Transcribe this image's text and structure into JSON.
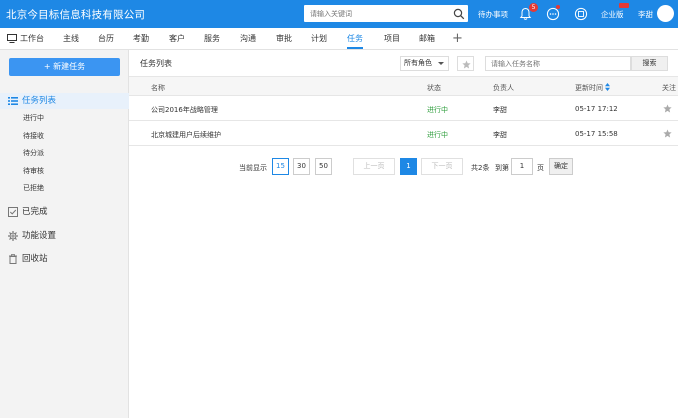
{
  "header": {
    "company": "北京今目标信息科技有限公司",
    "search_placeholder": "请输入关键词",
    "todo": "待办事项",
    "notif_count": "5",
    "enterprise": "企业版",
    "user": "李甜"
  },
  "nav": {
    "items": [
      "工作台",
      "主线",
      "台历",
      "考勤",
      "客户",
      "服务",
      "沟通",
      "审批",
      "计划",
      "任务",
      "项目",
      "邮箱"
    ],
    "active": "任务"
  },
  "sidebar": {
    "new_task": "+ 新建任务",
    "task_list": "任务列表",
    "sub_items": [
      "进行中",
      "待接收",
      "待分派",
      "待审核",
      "已拒绝"
    ],
    "completed": "已完成",
    "settings": "功能设置",
    "recycle": "回收站"
  },
  "main": {
    "title": "任务列表",
    "role_select": "所有角色",
    "search_placeholder": "请输入任务名称",
    "search_button": "搜索",
    "columns": [
      "名称",
      "状态",
      "负责人",
      "更新时间",
      "关注"
    ],
    "rows": [
      {
        "name": "公司2016年战略管理",
        "status": "进行中",
        "owner": "李甜",
        "updated": "05-17 17:12"
      },
      {
        "name": "北京城建用户后续维护",
        "status": "进行中",
        "owner": "李甜",
        "updated": "05-17 15:58"
      }
    ]
  },
  "pagination": {
    "show_label": "当前显示",
    "sizes": [
      "15",
      "30",
      "50"
    ],
    "prev": "上一页",
    "current": "1",
    "next": "下一页",
    "total": "共2条",
    "goto": "到第",
    "goto_value": "1",
    "page_unit": "页",
    "confirm": "确定"
  },
  "colors": {
    "primary": "#1e88e5",
    "status_green": "#2e9e3c",
    "badge_red": "#e53935",
    "sidebar_bg": "#f3f3f3"
  }
}
